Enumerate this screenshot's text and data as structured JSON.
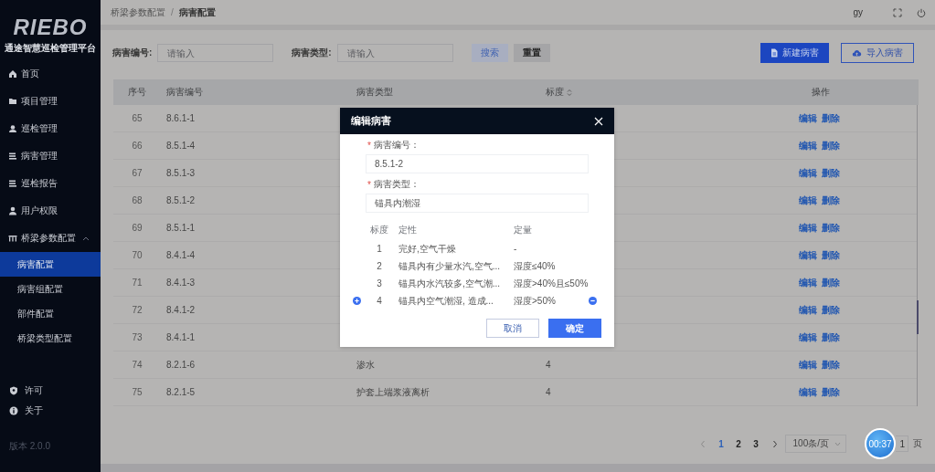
{
  "topbar": {
    "breadcrumb": [
      "桥梁参数配置",
      "病害配置"
    ],
    "separator": "/",
    "user": "gy"
  },
  "sidebar": {
    "logo": "RIEBO",
    "subtitle": "通途智慧巡检管理平台",
    "items": [
      {
        "label": "首页",
        "selected": false
      },
      {
        "label": "项目管理",
        "selected": false
      },
      {
        "label": "巡检管理",
        "selected": false
      },
      {
        "label": "病害管理",
        "selected": false
      },
      {
        "label": "巡检报告",
        "selected": false
      },
      {
        "label": "用户权限",
        "selected": false
      },
      {
        "label": "桥梁参数配置",
        "expanded": true,
        "children": [
          {
            "label": "病害配置",
            "selected": true
          },
          {
            "label": "病害组配置",
            "selected": false
          },
          {
            "label": "部件配置",
            "selected": false
          },
          {
            "label": "桥梁类型配置",
            "selected": false
          }
        ]
      }
    ],
    "footer_items": [
      {
        "label": "许可"
      },
      {
        "label": "关于"
      }
    ],
    "version": "版本 2.0.0"
  },
  "filters": {
    "fields": [
      {
        "label": "病害编号:",
        "placeholder": "请输入"
      },
      {
        "label": "病害类型:",
        "placeholder": "请输入"
      }
    ],
    "buttons": [
      {
        "label": "搜索",
        "kind": "search"
      },
      {
        "label": "重置",
        "kind": "reset"
      }
    ],
    "actions": [
      {
        "label": "新建病害",
        "kind": "primary"
      },
      {
        "label": "导入病害",
        "kind": "outline"
      }
    ]
  },
  "table": {
    "columns": [
      {
        "label": "序号",
        "sortable": false
      },
      {
        "label": "病害编号",
        "sortable": false
      },
      {
        "label": "病害类型",
        "sortable": false
      },
      {
        "label": "标度",
        "sortable": true
      },
      {
        "label": "操作",
        "sortable": false
      }
    ],
    "rows": [
      {
        "no": "65",
        "code": "8.6.1-1",
        "actions": [
          "编辑",
          "删除"
        ]
      },
      {
        "no": "66",
        "code": "8.5.1-4",
        "actions": [
          "编辑",
          "删除"
        ]
      },
      {
        "no": "67",
        "code": "8.5.1-3",
        "actions": [
          "编辑",
          "删除"
        ]
      },
      {
        "no": "68",
        "code": "8.5.1-2",
        "actions": [
          "编辑",
          "删除"
        ]
      },
      {
        "no": "69",
        "code": "8.5.1-1",
        "actions": [
          "编辑",
          "删除"
        ]
      },
      {
        "no": "70",
        "code": "8.4.1-4",
        "actions": [
          "编辑",
          "删除"
        ]
      },
      {
        "no": "71",
        "code": "8.4.1-3",
        "actions": [
          "编辑",
          "删除"
        ]
      },
      {
        "no": "72",
        "code": "8.4.1-2",
        "actions": [
          "编辑",
          "删除"
        ]
      },
      {
        "no": "73",
        "code": "8.4.1-1",
        "actions": [
          "编辑",
          "删除"
        ]
      },
      {
        "no": "74",
        "code": "8.2.1-6",
        "type": "渗水",
        "scale": "4",
        "actions": [
          "编辑",
          "删除"
        ]
      },
      {
        "no": "75",
        "code": "8.2.1-5",
        "type": "护套上端浆液离析",
        "scale": "4",
        "actions": [
          "编辑",
          "删除"
        ]
      }
    ]
  },
  "pagination": {
    "pages": [
      {
        "label": "1",
        "selected": true
      },
      {
        "label": "2",
        "selected": false
      },
      {
        "label": "3",
        "selected": false
      }
    ],
    "page_size": "100条/页",
    "jump_value": "1",
    "jump_suffix": "页"
  },
  "timer": "00:37",
  "dialog": {
    "title": "编辑病害",
    "fields": [
      {
        "mark": "*",
        "label": "病害编号：",
        "value": "8.5.1-2"
      },
      {
        "mark": "*",
        "label": "病害类型：",
        "value": "锚具内潮湿"
      }
    ],
    "grade_columns": [
      "标度",
      "定性",
      "定量"
    ],
    "grades": [
      {
        "grade": "1",
        "qualitative": "完好,空气干燥",
        "quantitative": "-"
      },
      {
        "grade": "2",
        "qualitative": "锚具内有少量水汽,空气...",
        "quantitative": "湿度≤40%"
      },
      {
        "grade": "3",
        "qualitative": "锚具内水汽较多,空气潮...",
        "quantitative": "湿度>40%且≤50%"
      },
      {
        "grade": "4",
        "qualitative": "锚具内空气潮湿, 造成...",
        "quantitative": "湿度>50%"
      }
    ],
    "buttons": [
      {
        "label": "取消",
        "kind": "secondary"
      },
      {
        "label": "确定",
        "kind": "primary"
      }
    ]
  }
}
